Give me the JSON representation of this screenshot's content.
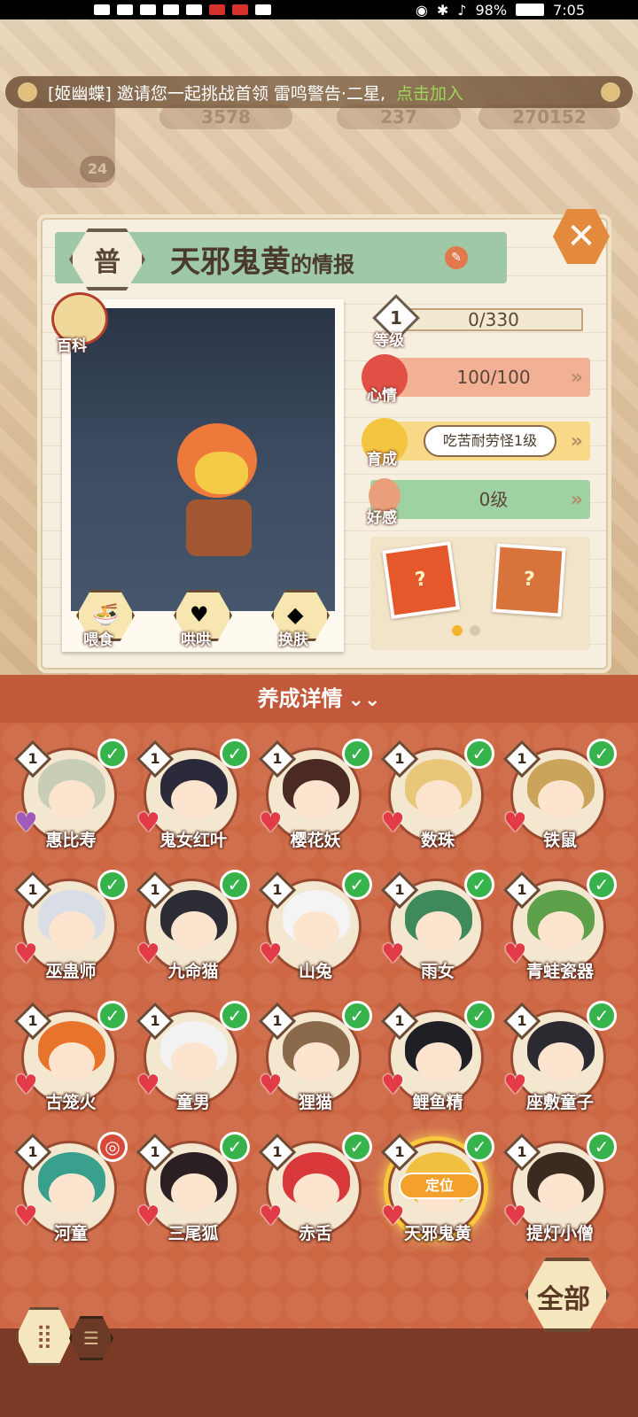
{
  "status_bar": {
    "battery": "98%",
    "time": "7:05"
  },
  "invite_banner": {
    "text": "[姬幽蝶] 邀请您一起挑战首领 雷鸣警告·二星,",
    "join_label": "点击加入"
  },
  "resources": {
    "currency1": "3578",
    "currency2": "237",
    "currency3": "270152"
  },
  "player": {
    "level": "24"
  },
  "info_card": {
    "rarity": "普",
    "name": "天邪鬼黄",
    "title_suffix": "的情报",
    "baike_label": "百科",
    "level": {
      "label": "等级",
      "value": "1",
      "exp": "0/330"
    },
    "mood": {
      "label": "心情",
      "value": "100/100"
    },
    "growth": {
      "label": "育成",
      "value": "吃苦耐劳怪1级"
    },
    "favor": {
      "label": "好感",
      "value": "0级"
    },
    "actions": [
      {
        "label": "喂食",
        "icon": "bowl-icon"
      },
      {
        "label": "哄哄",
        "icon": "milk-icon"
      },
      {
        "label": "换肤",
        "icon": "skin-icon"
      }
    ],
    "card_slots": [
      "?",
      "?"
    ],
    "page_dots": {
      "count": 2,
      "active": 0
    }
  },
  "collection": {
    "header": "养成详情",
    "all_button": "全部",
    "locate_label": "定位",
    "items": [
      {
        "name": "惠比寿",
        "level": "1",
        "hair": "#c8cdb6",
        "heart": "purple",
        "status": "check"
      },
      {
        "name": "鬼女红叶",
        "level": "1",
        "hair": "#2b2a3a",
        "heart": "red",
        "status": "check"
      },
      {
        "name": "樱花妖",
        "level": "1",
        "hair": "#4a2a22",
        "heart": "red",
        "status": "check"
      },
      {
        "name": "数珠",
        "level": "1",
        "hair": "#e9c77a",
        "heart": "red",
        "status": "check"
      },
      {
        "name": "铁鼠",
        "level": "1",
        "hair": "#c9a45a",
        "heart": "red",
        "status": "check"
      },
      {
        "name": "巫蛊师",
        "level": "1",
        "hair": "#d8dde6",
        "heart": "red",
        "status": "check"
      },
      {
        "name": "九命猫",
        "level": "1",
        "hair": "#2c2c34",
        "heart": "red",
        "status": "check"
      },
      {
        "name": "山兔",
        "level": "1",
        "hair": "#f4f4f4",
        "heart": "red",
        "status": "check"
      },
      {
        "name": "雨女",
        "level": "1",
        "hair": "#3f8a5a",
        "heart": "red",
        "status": "check"
      },
      {
        "name": "青蛙瓷器",
        "level": "1",
        "hair": "#5fa04a",
        "heart": "red",
        "status": "check"
      },
      {
        "name": "古笼火",
        "level": "1",
        "hair": "#e8742c",
        "heart": "red",
        "status": "check"
      },
      {
        "name": "童男",
        "level": "1",
        "hair": "#f2f2f2",
        "heart": "red",
        "status": "check"
      },
      {
        "name": "狸猫",
        "level": "1",
        "hair": "#8a6a4a",
        "heart": "red",
        "status": "check"
      },
      {
        "name": "鲤鱼精",
        "level": "1",
        "hair": "#1f1f26",
        "heart": "red",
        "status": "check"
      },
      {
        "name": "座敷童子",
        "level": "1",
        "hair": "#2a2a30",
        "heart": "red",
        "status": "check"
      },
      {
        "name": "河童",
        "level": "1",
        "hair": "#3aa08e",
        "heart": "red",
        "status": "alt"
      },
      {
        "name": "三尾狐",
        "level": "1",
        "hair": "#2a1f22",
        "heart": "red",
        "status": "check"
      },
      {
        "name": "赤舌",
        "level": "1",
        "hair": "#d8383a",
        "heart": "red",
        "status": "check"
      },
      {
        "name": "天邪鬼黄",
        "level": "1",
        "hair": "#f0c040",
        "heart": "red",
        "status": "check",
        "selected": true
      },
      {
        "name": "提灯小僧",
        "level": "1",
        "hair": "#3a2a20",
        "heart": "red",
        "status": "check"
      }
    ]
  },
  "colors": {
    "accent": "#cd6744",
    "header": "#c2593a",
    "check": "#36b34a",
    "mood": "#f2b095",
    "growth": "#f7d987",
    "favor": "#9ed2a3"
  }
}
